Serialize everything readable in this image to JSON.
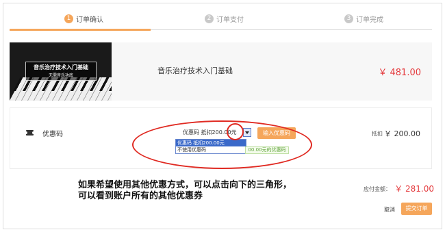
{
  "steps": [
    {
      "num": "1",
      "label": "订单确认"
    },
    {
      "num": "2",
      "label": "订单支付"
    },
    {
      "num": "3",
      "label": "订单完成"
    }
  ],
  "product": {
    "thumb_title": "音乐治疗技术入门基础",
    "thumb_subtitle": "无需音乐功底",
    "name": "音乐治疗技术入门基础",
    "price": "￥ 481.00"
  },
  "coupon": {
    "label": "优惠码",
    "selected_value": "优惠码 抵扣200.00元",
    "options": [
      "优惠码 抵扣200.00元",
      "不使用优惠码"
    ],
    "hint_text": "00.00元的优惠码",
    "input_button": "输入优惠码",
    "deduct_label": "抵扣",
    "deduct_value": "￥ 200.00"
  },
  "annotation": {
    "line1": "如果希望使用其他优惠方式，可以点击向下的三角形，",
    "line2": "可以看到账户所有的其他优惠券"
  },
  "summary": {
    "total_label": "应付金额：",
    "total_value": "￥ 281.00",
    "cancel_label": "取消",
    "submit_label": "提交订单"
  },
  "colors": {
    "accent": "#f5a65b",
    "price_red": "#e4393c",
    "annotation_red": "#e02a22",
    "dropdown_selected": "#3a69c9"
  }
}
